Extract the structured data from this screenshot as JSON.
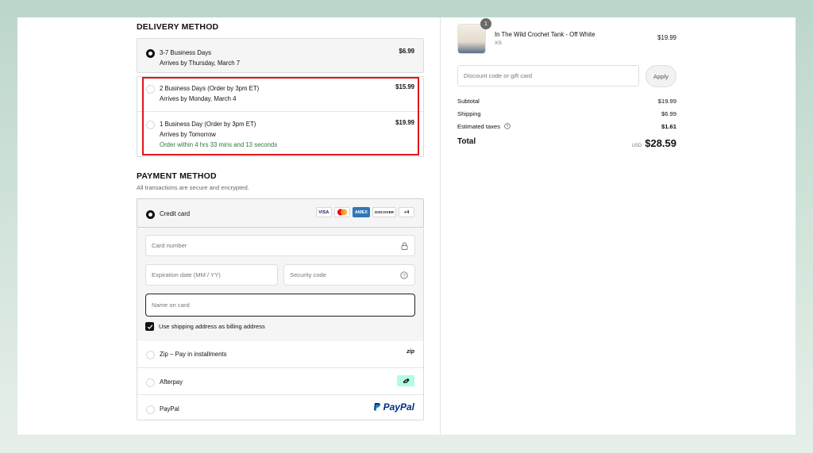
{
  "delivery": {
    "title": "DELIVERY METHOD",
    "options": [
      {
        "name": "3-7 Business Days",
        "detail": "Arrives by Thursday, March 7",
        "price": "$6.99"
      },
      {
        "name": "2 Business Days (Order by 3pm ET)",
        "detail": "Arrives by Monday, March 4",
        "price": "$15.99"
      },
      {
        "name": "1 Business Day (Order by 3pm ET)",
        "detail": "Arrives by Tomorrow",
        "note": "Order within 4 hrs 33 mins and 13 seconds",
        "price": "$19.99"
      }
    ]
  },
  "payment": {
    "title": "PAYMENT METHOD",
    "subtitle": "All transactions are secure and encrypted.",
    "credit_card_label": "Credit card",
    "brands": [
      "VISA",
      "MC",
      "AMEX",
      "DISCOVER",
      "+4"
    ],
    "fields": {
      "card_number": "Card number",
      "expiration": "Expiration date (MM / YY)",
      "security": "Security code",
      "name": "Name on card"
    },
    "billing_checkbox": "Use shipping address as billing address",
    "zip_label": "Zip – Pay in installments",
    "zip_logo": "zip",
    "afterpay_label": "Afterpay",
    "paypal_label": "PayPal",
    "paypal_logo": "PayPal"
  },
  "order": {
    "qty_badge": "1",
    "product_name": "In The Wild Crochet Tank - Off White",
    "product_variant": "XS",
    "product_price": "$19.99",
    "discount_placeholder": "Discount code or gift card",
    "apply_label": "Apply",
    "subtotal_label": "Subtotal",
    "subtotal_value": "$19.99",
    "shipping_label": "Shipping",
    "shipping_value": "$6.99",
    "taxes_label": "Estimated taxes",
    "taxes_value": "$1.61",
    "total_label": "Total",
    "currency": "USD",
    "total_value": "$28.59"
  },
  "colors": {
    "highlight": "#e0161b",
    "accent_green": "#2f7a3c",
    "afterpay_mint": "#b2fce4",
    "paypal_blue": "#003087"
  }
}
